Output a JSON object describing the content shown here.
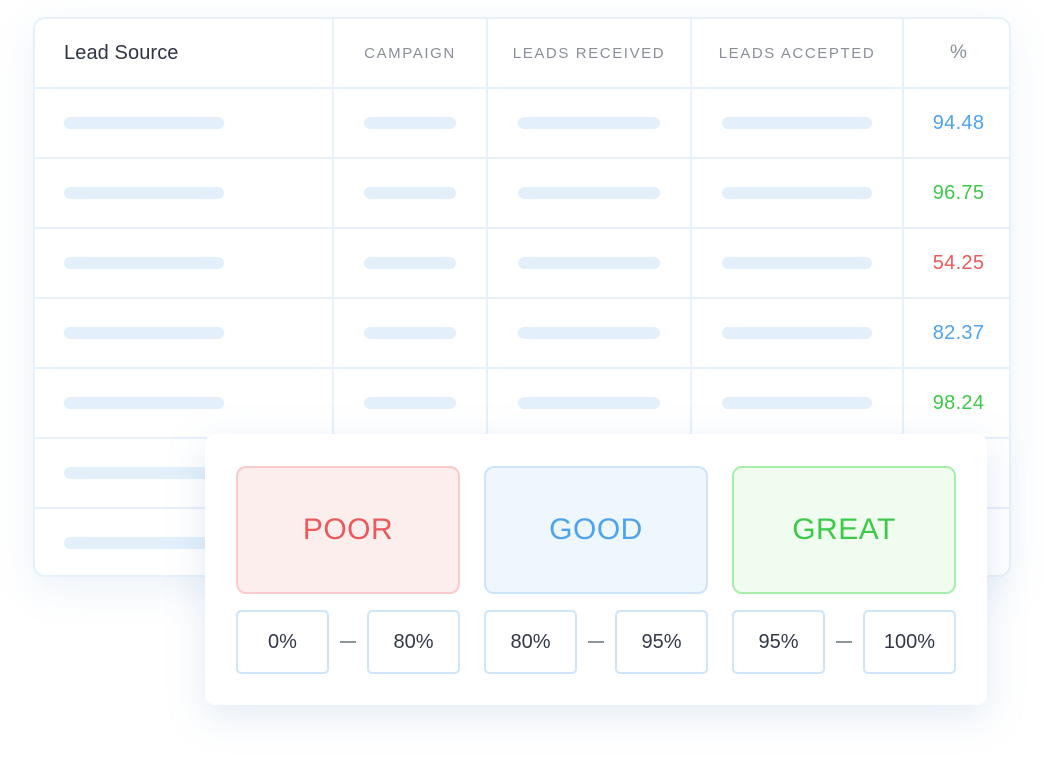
{
  "table": {
    "headers": {
      "lead_source": "Lead Source",
      "campaign": "CAMPAIGN",
      "leads_received": "LEADS RECEIVED",
      "leads_accepted": "LEADS ACCEPTED",
      "percent": "%"
    },
    "rows": [
      {
        "percent": "94.48",
        "color": "#4fa3ee"
      },
      {
        "percent": "96.75",
        "color": "#3fc94a"
      },
      {
        "percent": "54.25",
        "color": "#ea5a5a"
      },
      {
        "percent": "82.37",
        "color": "#4fa3ee"
      },
      {
        "percent": "98.24",
        "color": "#3fc94a"
      },
      {
        "percent": "",
        "color": ""
      },
      {
        "percent": "",
        "color": ""
      }
    ]
  },
  "legend": {
    "tiers": [
      {
        "label": "POOR",
        "text_color": "#ea5a5a",
        "bg": "#fdeeee",
        "border": "#fbcaca",
        "min": "0%",
        "max": "80%"
      },
      {
        "label": "GOOD",
        "text_color": "#4fa3ee",
        "bg": "#eef6fe",
        "border": "#cde4fa",
        "min": "80%",
        "max": "95%"
      },
      {
        "label": "GREAT",
        "text_color": "#3fc94a",
        "bg": "#effcef",
        "border": "#a8eeab",
        "min": "95%",
        "max": "100%"
      }
    ],
    "separator": "—"
  }
}
